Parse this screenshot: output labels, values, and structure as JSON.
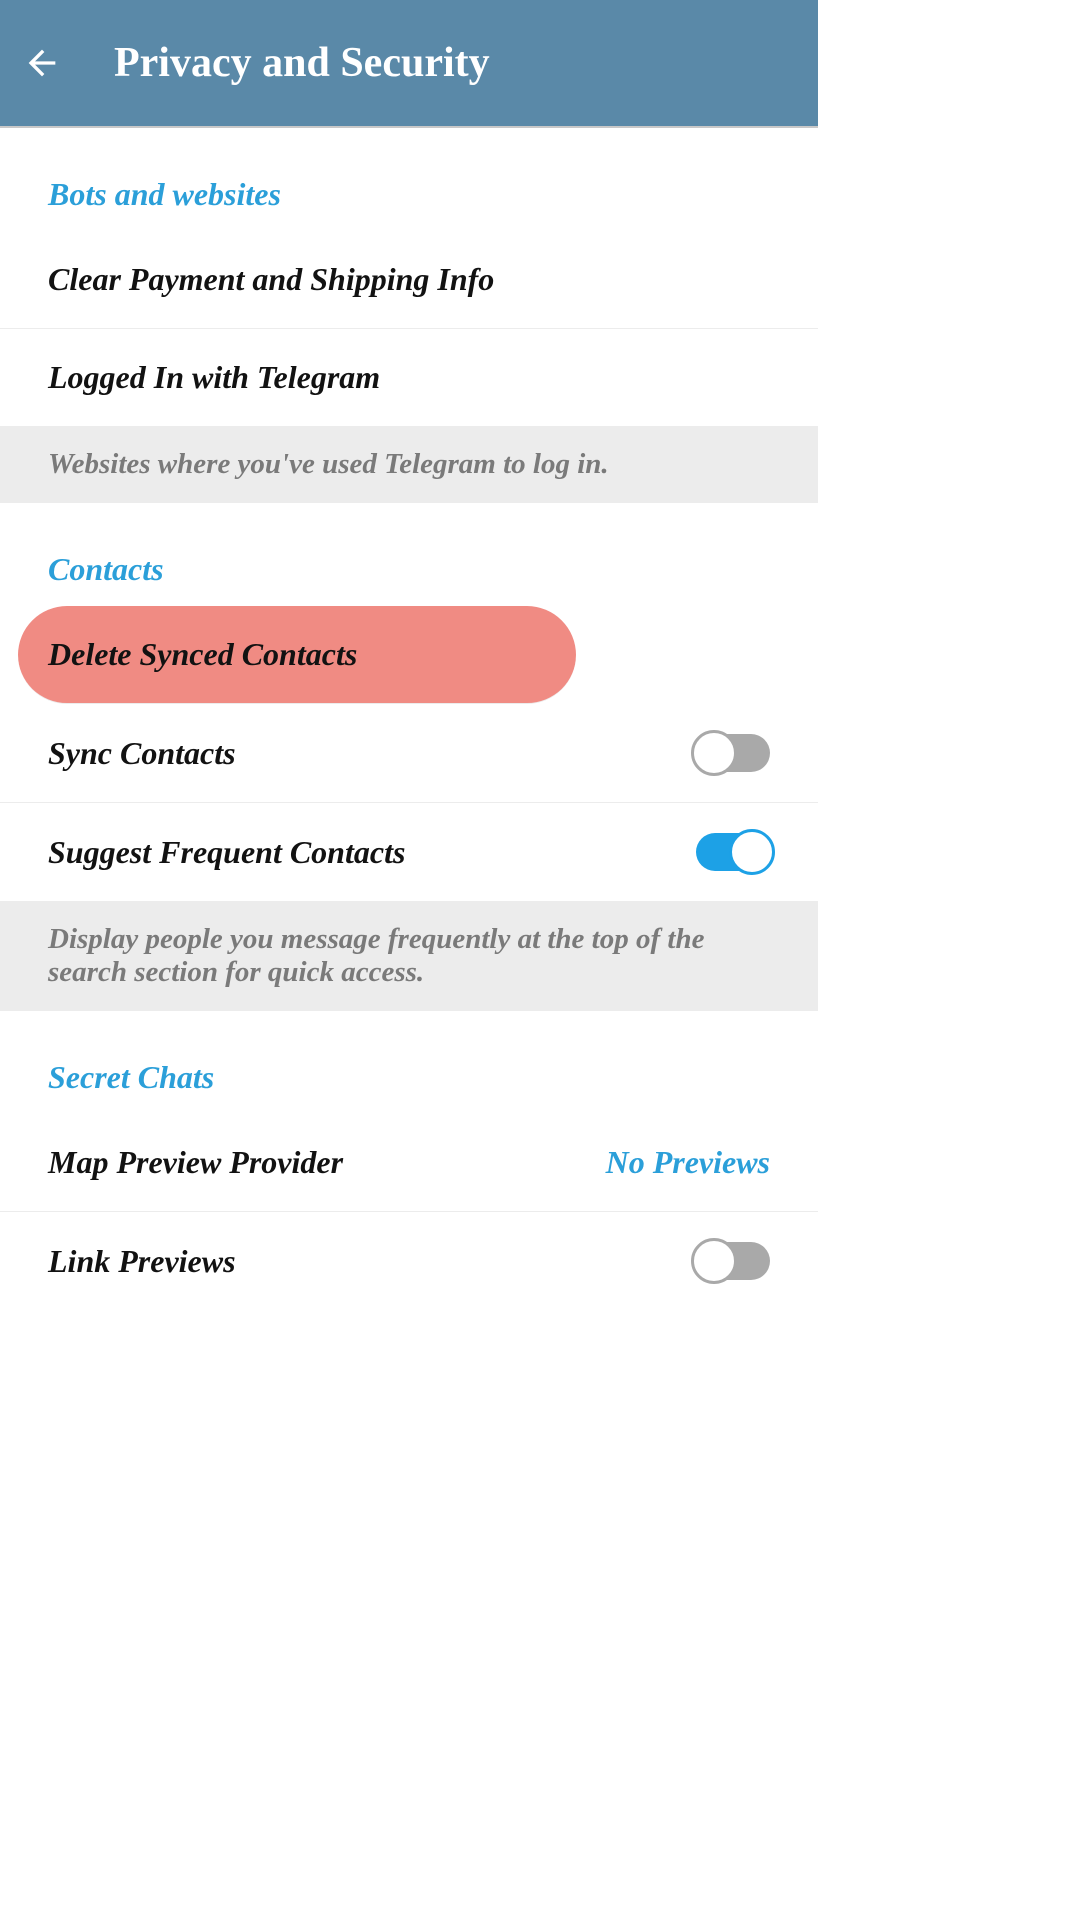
{
  "header": {
    "title": "Privacy and Security"
  },
  "sections": {
    "bots_websites": {
      "title": "Bots and websites",
      "clear_payment": "Clear Payment and Shipping Info",
      "logged_in": "Logged In with Telegram",
      "footer": "Websites where you've used Telegram to log in."
    },
    "contacts": {
      "title": "Contacts",
      "delete_synced": "Delete Synced Contacts",
      "sync_contacts": "Sync Contacts",
      "sync_contacts_toggle": false,
      "suggest_frequent": "Suggest Frequent Contacts",
      "suggest_frequent_toggle": true,
      "footer": "Display people you message frequently at the top of the search section for quick access."
    },
    "secret_chats": {
      "title": "Secret Chats",
      "map_preview": "Map Preview Provider",
      "map_preview_value": "No Previews",
      "link_previews": "Link Previews",
      "link_previews_toggle": false
    }
  }
}
